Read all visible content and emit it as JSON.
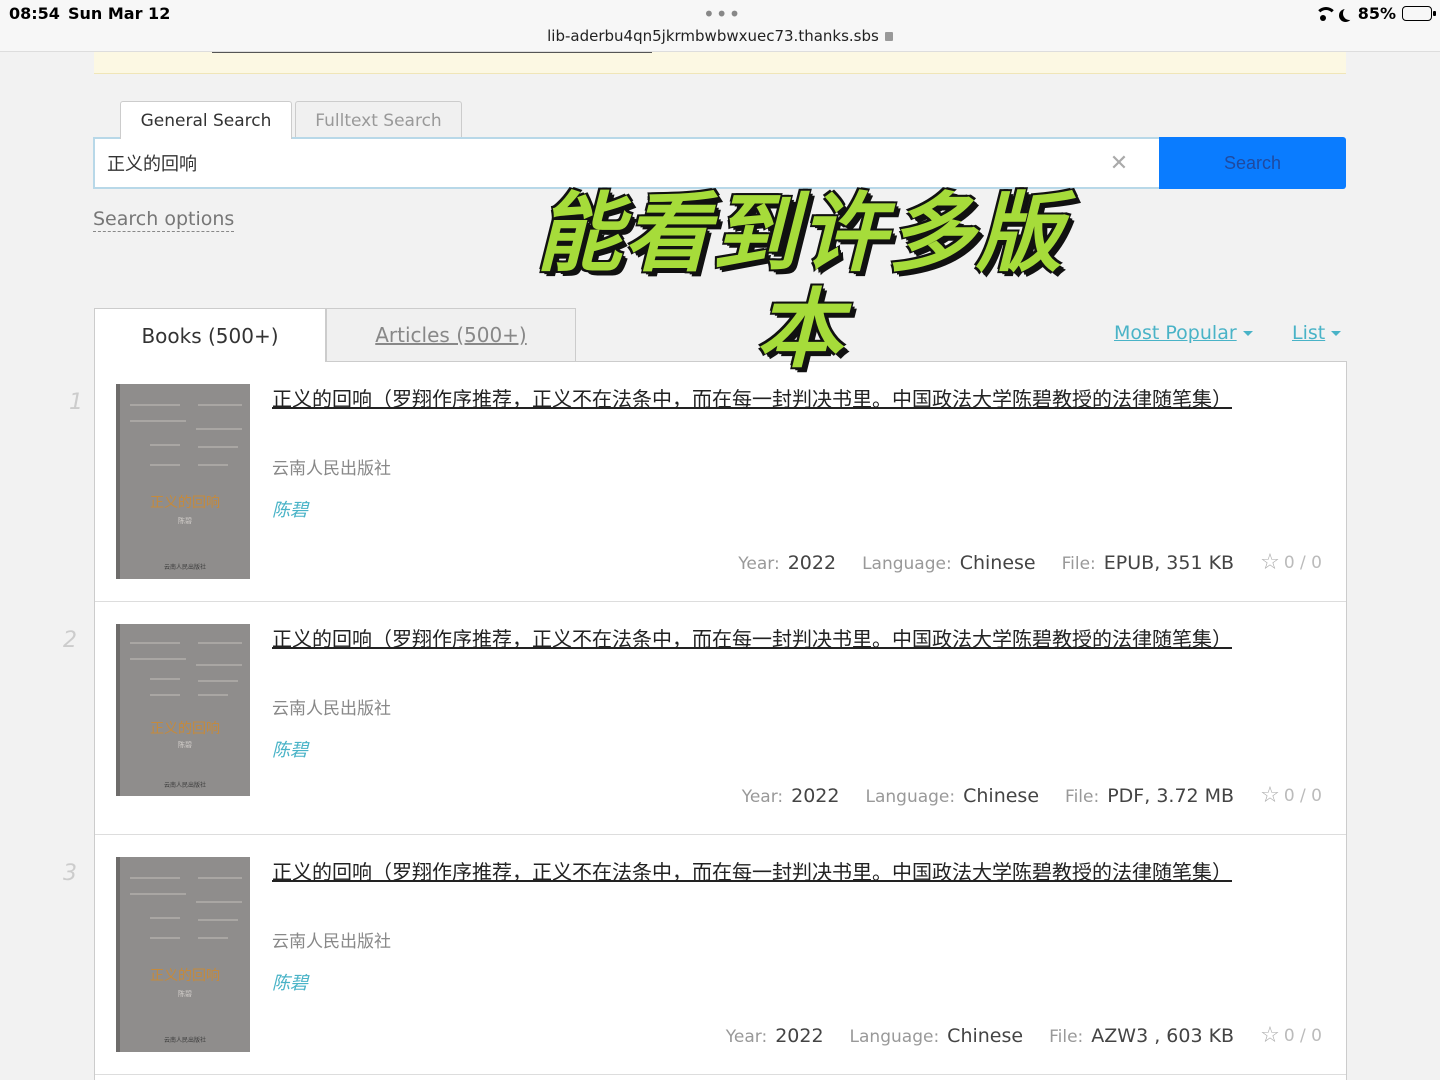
{
  "status": {
    "time": "08:54",
    "date": "Sun Mar 12",
    "url": "lib-aderbu4qn5jkrmbwbwxuec73.thanks.sbs",
    "battery": "85%",
    "battery_level": 0.85
  },
  "search": {
    "tab_general": "General Search",
    "tab_fulltext": "Fulltext Search",
    "query": "正义的回响",
    "button": "Search",
    "options": "Search options"
  },
  "overlay": {
    "line1": "能看到许多版",
    "line2": "本"
  },
  "result_tabs": {
    "books": "Books (500+)",
    "articles": "Articles (500+)"
  },
  "sort": {
    "popular": "Most Popular",
    "view": "List"
  },
  "labels": {
    "year": "Year:",
    "language": "Language:",
    "file": "File:"
  },
  "cover_title": "正义的回响",
  "results": [
    {
      "num": "1",
      "title": "正义的回响（罗翔作序推荐，正义不在法条中，而在每一封判决书里。中国政法大学陈碧教授的法律随笔集）",
      "publisher": "云南人民出版社",
      "author": "陈碧",
      "year": "2022",
      "language": "Chinese",
      "file": "EPUB, 351 KB",
      "rating": "0 / 0"
    },
    {
      "num": "2",
      "title": "正义的回响（罗翔作序推荐，正义不在法条中，而在每一封判决书里。中国政法大学陈碧教授的法律随笔集）",
      "publisher": "云南人民出版社",
      "author": "陈碧",
      "year": "2022",
      "language": "Chinese",
      "file": "PDF, 3.72 MB",
      "rating": "0 / 0"
    },
    {
      "num": "3",
      "title": "正义的回响（罗翔作序推荐，正义不在法条中，而在每一封判决书里。中国政法大学陈碧教授的法律随笔集）",
      "publisher": "云南人民出版社",
      "author": "陈碧",
      "year": "2022",
      "language": "Chinese",
      "file": "AZW3 , 603 KB",
      "rating": "0 / 0"
    }
  ]
}
